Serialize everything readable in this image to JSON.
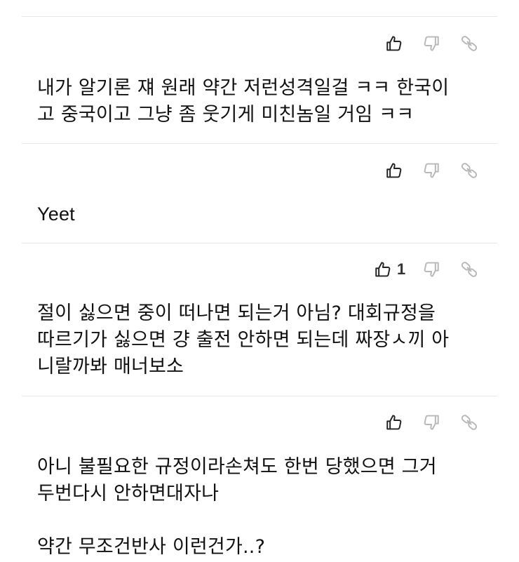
{
  "comments": [
    {
      "text": "내가 알기론 쟤 원래 약간 저런성격일걸 ㅋㅋ 한국이\n고 중국이고 그냥 좀 웃기게 미친놈일 거임 ㅋㅋ",
      "likes": ""
    },
    {
      "text": "Yeet",
      "likes": ""
    },
    {
      "text": "절이 싫으면 중이 떠나면 되는거 아님? 대회규정을\n따르기가 싫으면 걍 출전 안하면 되는데 짜장ㅅ끼 아\n니랄까봐 매너보소",
      "likes": "1"
    },
    {
      "text": "아니 불필요한 규정이라손쳐도 한번 당했으면 그거\n두번다시 안하면대자나\n\n약간 무조건반사 이런건가..?",
      "likes": ""
    }
  ],
  "icons": {
    "like": "thumbs-up-icon",
    "dislike": "thumbs-down-icon",
    "share": "link-icon"
  },
  "colors": {
    "text": "#111111",
    "like_icon": "#222222",
    "muted_icon": "#b8b8b8",
    "divider": "#e6e6e6"
  }
}
